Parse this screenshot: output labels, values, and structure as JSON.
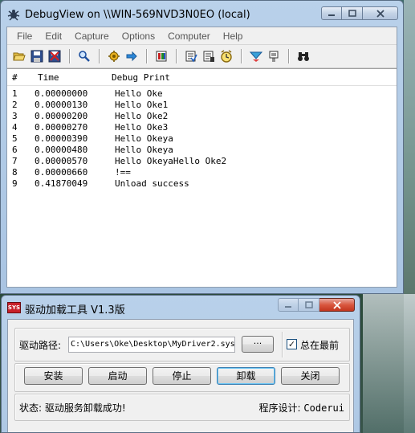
{
  "debugview": {
    "title": "DebugView on \\\\WIN-569NVD3N0EO (local)",
    "menu": [
      "File",
      "Edit",
      "Capture",
      "Options",
      "Computer",
      "Help"
    ],
    "toolbar_icons": [
      "open-icon",
      "save-icon",
      "clear-display-icon",
      "find-icon",
      "capture-icon",
      "autoscroll-icon",
      "history-depth-icon",
      "filter-icon",
      "highlight-icon",
      "clock-icon",
      "log-to-file-icon",
      "bookmark-icon",
      "binoculars-icon"
    ],
    "columns": {
      "num": "#",
      "time": "Time",
      "msg": "Debug Print"
    },
    "rows": [
      {
        "num": "1",
        "time": "0.00000000",
        "msg": "Hello Oke"
      },
      {
        "num": "2",
        "time": "0.00000130",
        "msg": "Hello Oke1"
      },
      {
        "num": "3",
        "time": "0.00000200",
        "msg": "Hello Oke2"
      },
      {
        "num": "4",
        "time": "0.00000270",
        "msg": "Hello Oke3"
      },
      {
        "num": "5",
        "time": "0.00000390",
        "msg": "Hello Okeya"
      },
      {
        "num": "6",
        "time": "0.00000480",
        "msg": "Hello Okeya"
      },
      {
        "num": "7",
        "time": "0.00000570",
        "msg": "Hello OkeyaHello Oke2"
      },
      {
        "num": "8",
        "time": "0.00000660",
        "msg": "!=="
      },
      {
        "num": "9",
        "time": "0.41870049",
        "msg": "Unload success"
      }
    ]
  },
  "loader": {
    "icon_text": "SYS",
    "title": "驱动加载工具 V1.3版",
    "path_label": "驱动路径:",
    "path_value": "C:\\Users\\Oke\\Desktop\\MyDriver2.sys",
    "browse_label": "···",
    "topmost_label": "总在最前",
    "topmost_checked": true,
    "check_mark": "✓",
    "buttons": {
      "install": "安装",
      "start": "启动",
      "stop": "停止",
      "uninstall": "卸载",
      "close": "关闭"
    },
    "status": "状态: 驱动服务卸载成功!",
    "credit_label": "程序设计:",
    "credit_name": "Coderui"
  },
  "colors": {
    "title_bar": "#b9d1ea",
    "window_face": "#f0f0f0",
    "sys_icon": "#c8202a"
  }
}
